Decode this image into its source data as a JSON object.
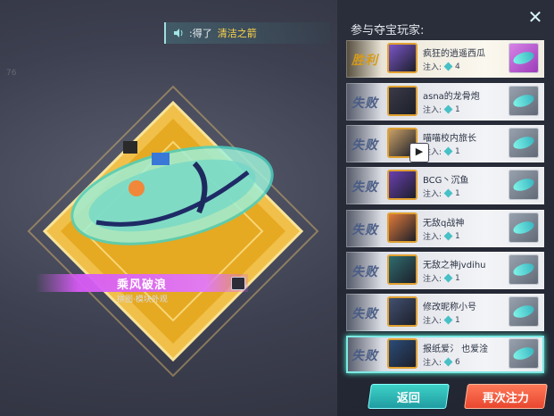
{
  "notice": {
    "prefix": ":得了",
    "item": "清洁之箭"
  },
  "corner_label": "76",
  "prize": {
    "name": "乘风破浪",
    "subtitle": "拼图·模块外观"
  },
  "panel": {
    "title": "参与夺宝玩家:",
    "close_icon": "close-icon"
  },
  "players": [
    {
      "result": "胜利",
      "name": "疯狂的逍遥西瓜",
      "bet_label": "注入:",
      "bet": "4",
      "avatar_color": "#7a55c8",
      "reward": "gold"
    },
    {
      "result": "失败",
      "name": "asna的龙骨炮",
      "bet_label": "注入:",
      "bet": "1",
      "avatar_color": "#3b3a48",
      "reward": "gray"
    },
    {
      "result": "失败",
      "name": "喵喵校内旅长",
      "bet_label": "注入:",
      "bet": "1",
      "avatar_color": "#c9a066",
      "reward": "gray"
    },
    {
      "result": "失败",
      "name": "BCG丶沉鱼",
      "bet_label": "注入:",
      "bet": "1",
      "avatar_color": "#6a3fb0",
      "reward": "gray"
    },
    {
      "result": "失败",
      "name": "无敌q战神",
      "bet_label": "注入:",
      "bet": "1",
      "avatar_color": "#e07a3a",
      "reward": "gray"
    },
    {
      "result": "失败",
      "name": "无敌之神jvdihu",
      "bet_label": "注入:",
      "bet": "1",
      "avatar_color": "#2f6d6e",
      "reward": "gray"
    },
    {
      "result": "失败",
      "name": "修改昵称小号",
      "bet_label": "注入:",
      "bet": "1",
      "avatar_color": "#425070",
      "reward": "gray"
    },
    {
      "result": "失败",
      "name": "报纸爱氵 也爱淦",
      "bet_label": "注入:",
      "bet": "6",
      "avatar_color": "#2b4c78",
      "reward": "gray"
    }
  ],
  "buttons": {
    "back": "返回",
    "again": "再次注力"
  }
}
